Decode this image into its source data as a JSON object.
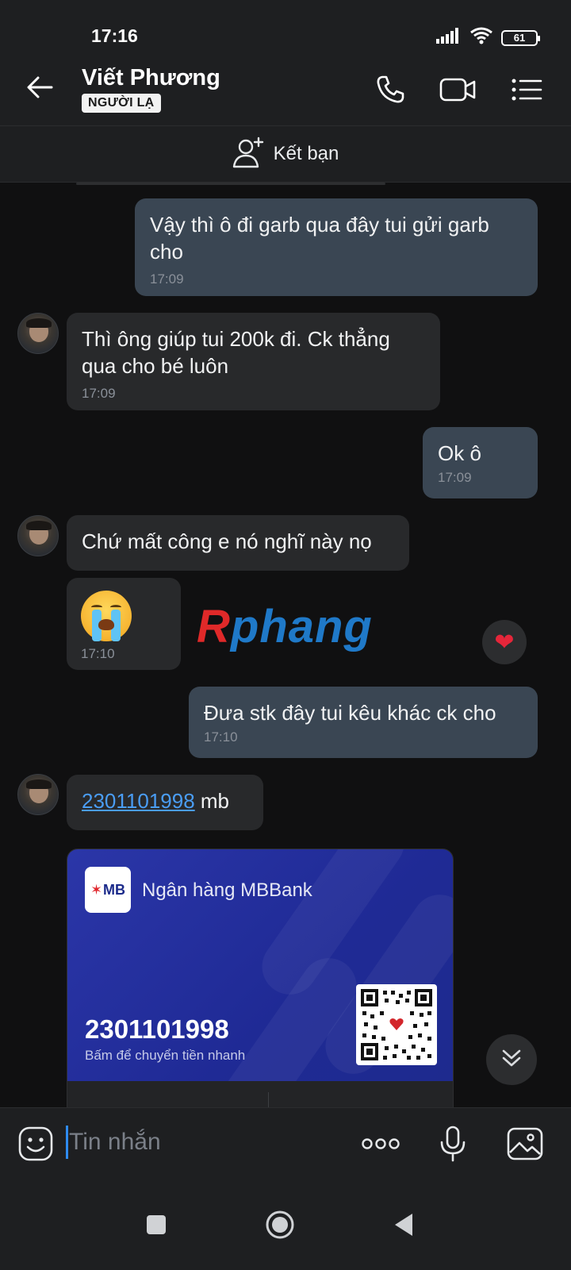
{
  "status_bar": {
    "time": "17:16",
    "battery": "61"
  },
  "header": {
    "contact_name": "Viết Phương",
    "badge": "NGƯỜI LẠ",
    "icons": [
      "back-arrow-icon",
      "phone-icon",
      "video-call-icon",
      "menu-list-icon"
    ]
  },
  "add_friend": {
    "label": "Kết bạn",
    "icon": "add-user-icon"
  },
  "messages": [
    {
      "direction": "out",
      "text": "Vậy thì ô đi garb qua đây tui gửi garb cho",
      "time": "17:09"
    },
    {
      "direction": "in",
      "text": "Thì ông giúp tui 200k đi. Ck thẳng qua cho bé luôn",
      "time": "17:09"
    },
    {
      "direction": "out",
      "text": "Ok ô",
      "time": "17:09"
    },
    {
      "direction": "in",
      "text": "Chứ mất công e nó nghĩ này nọ"
    },
    {
      "direction": "in",
      "type": "sticker",
      "sticker": "crying-face-emoji",
      "time": "17:10",
      "reaction": "❤"
    },
    {
      "direction": "out",
      "text": "Đưa stk đây tui kêu khác ck cho",
      "time": "17:10"
    },
    {
      "direction": "in",
      "link": "2301101998",
      "text": " mb"
    }
  ],
  "watermark": {
    "r": "R",
    "rest": "phang"
  },
  "bank_card": {
    "logo": "MB",
    "bank_name": "Ngân hàng MBBank",
    "account_number": "2301101998",
    "hint": "Bấm để chuyển tiền nhanh"
  },
  "composer": {
    "placeholder": "Tin nhắn",
    "icons": [
      "emoji-icon",
      "more-icon",
      "microphone-icon",
      "image-icon"
    ]
  },
  "navbar": {
    "icons": [
      "recent-apps-icon",
      "home-icon",
      "back-icon"
    ]
  }
}
